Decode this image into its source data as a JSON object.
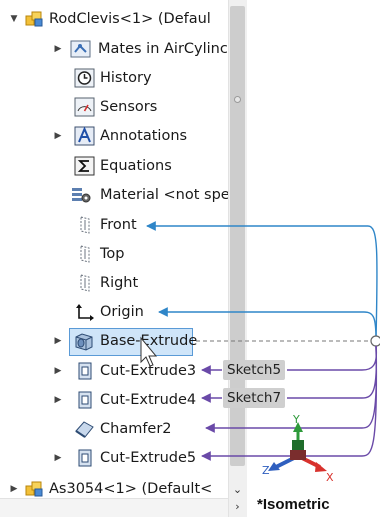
{
  "tree": {
    "root": "RodClevis<1> (Defaul",
    "items": [
      {
        "label": "Mates in AirCylinc"
      },
      {
        "label": "History"
      },
      {
        "label": "Sensors"
      },
      {
        "label": "Annotations"
      },
      {
        "label": "Equations"
      },
      {
        "label": "Material <not spe"
      },
      {
        "label": "Front"
      },
      {
        "label": "Top"
      },
      {
        "label": "Right"
      },
      {
        "label": "Origin"
      },
      {
        "label": "Base-Extrude"
      },
      {
        "label": "Cut-Extrude3"
      },
      {
        "label": "Cut-Extrude4"
      },
      {
        "label": "Chamfer2"
      },
      {
        "label": "Cut-Extrude5"
      }
    ],
    "next_root": "As3054<1> (Default<"
  },
  "overlay": {
    "sketch5": "Sketch5",
    "sketch7": "Sketch7",
    "view_label": "*Isometric",
    "axis_x": "X",
    "axis_y": "Y",
    "axis_z": "Z"
  },
  "colors": {
    "selection": "#cfe5f9",
    "blue_arrow": "#2f86c8",
    "purple_arrow": "#6a4aa8",
    "axis_x": "#d8322d",
    "axis_y": "#2e9a3a",
    "axis_z": "#2f5fbf"
  }
}
